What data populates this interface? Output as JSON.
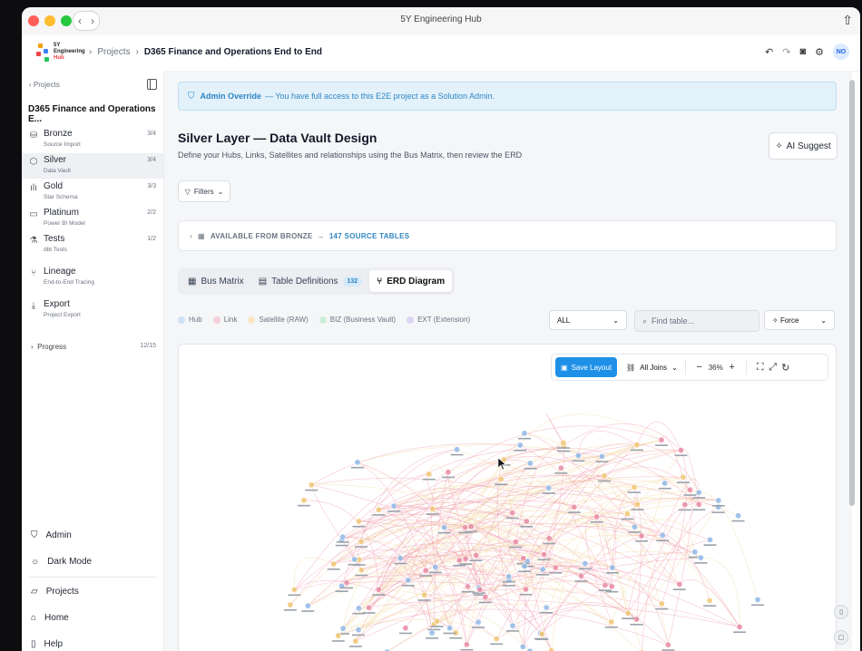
{
  "window": {
    "title": "5Y Engineering Hub"
  },
  "brand": {
    "line1": "5Y",
    "line2": "Engineering",
    "line3": "Hub"
  },
  "breadcrumb": {
    "projects": "Projects",
    "current": "D365 Finance and Operations End to End"
  },
  "user": {
    "initials": "NO"
  },
  "sidebar": {
    "back_label": "Projects",
    "project_title": "D365 Finance and Operations E...",
    "items": [
      {
        "label": "Bronze",
        "sub": "Source Import",
        "count": "3/4",
        "icon": "database-icon"
      },
      {
        "label": "Silver",
        "sub": "Data Vault",
        "count": "3/4",
        "icon": "hexagon-icon"
      },
      {
        "label": "Gold",
        "sub": "Star Schema",
        "count": "3/3",
        "icon": "bar-chart-icon"
      },
      {
        "label": "Platinum",
        "sub": "Power BI Model",
        "count": "2/2",
        "icon": "monitor-icon"
      },
      {
        "label": "Tests",
        "sub": "dbt Tests",
        "count": "1/2",
        "icon": "flask-icon"
      },
      {
        "label": "Lineage",
        "sub": "End-to-End Tracing",
        "count": "",
        "icon": "lineage-icon"
      },
      {
        "label": "Export",
        "sub": "Project Export",
        "count": "",
        "icon": "download-icon"
      }
    ],
    "progress_label": "Progress",
    "progress_count": "12/15",
    "bottom": {
      "admin": "Admin",
      "dark_mode": "Dark Mode",
      "projects": "Projects",
      "home": "Home",
      "help": "Help"
    }
  },
  "alert": {
    "title": "Admin Override",
    "message": "— You have full access to this E2E project as a Solution Admin."
  },
  "page": {
    "title": "Silver Layer — Data Vault Design",
    "subtitle": "Define your Hubs, Links, Satellites and relationships using the Bus Matrix, then review the ERD",
    "ai_suggest": "AI Suggest",
    "filters": "Filters"
  },
  "available": {
    "label": "AVAILABLE FROM BRONZE",
    "count_label": "147 SOURCE TABLES"
  },
  "tabs": [
    {
      "label": "Bus Matrix",
      "badge": ""
    },
    {
      "label": "Table Definitions",
      "badge": "132"
    },
    {
      "label": "ERD Diagram",
      "badge": ""
    }
  ],
  "legend": [
    {
      "label": "Hub",
      "color": "#cfe2f7"
    },
    {
      "label": "Link",
      "color": "#f7cfd9"
    },
    {
      "label": "Satellite (RAW)",
      "color": "#f8e7c2"
    },
    {
      "label": "BIZ (Business Vault)",
      "color": "#cdeed6"
    },
    {
      "label": "EXT (Extension)",
      "color": "#ddd5f5"
    }
  ],
  "controls": {
    "type_filter": "ALL",
    "find_placeholder": "Find table...",
    "layout": "Force"
  },
  "toolbar": {
    "save_label": "Save Layout",
    "joins_label": "All Joins",
    "zoom": "36%"
  },
  "colors": {
    "accent": "#1e90e8",
    "hub": "#8fb8e8",
    "link": "#e88ba4",
    "sat": "#f0c774"
  }
}
